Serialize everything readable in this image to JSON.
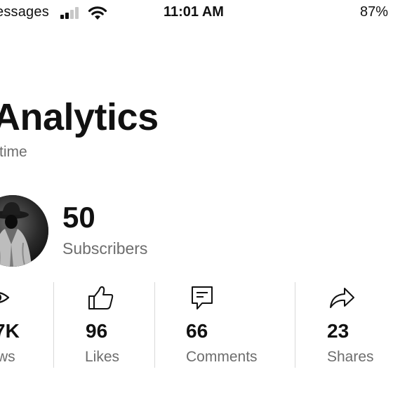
{
  "status_bar": {
    "carrier": "essages",
    "time": "11:01 AM",
    "battery": "87%"
  },
  "header": {
    "title": "Analytics",
    "subtitle": "time"
  },
  "profile": {
    "subscriber_count": "50",
    "subscriber_label": "Subscribers"
  },
  "stats": [
    {
      "icon": "eye-icon",
      "value": "7K",
      "label": "ws"
    },
    {
      "icon": "thumbs-up-icon",
      "value": "96",
      "label": "Likes"
    },
    {
      "icon": "comment-icon",
      "value": "66",
      "label": "Comments"
    },
    {
      "icon": "share-arrow-icon",
      "value": "23",
      "label": "Shares"
    }
  ],
  "colors": {
    "text": "#111111",
    "secondary_text": "#6d6d6d",
    "divider": "#d9d9d9",
    "background": "#ffffff"
  }
}
